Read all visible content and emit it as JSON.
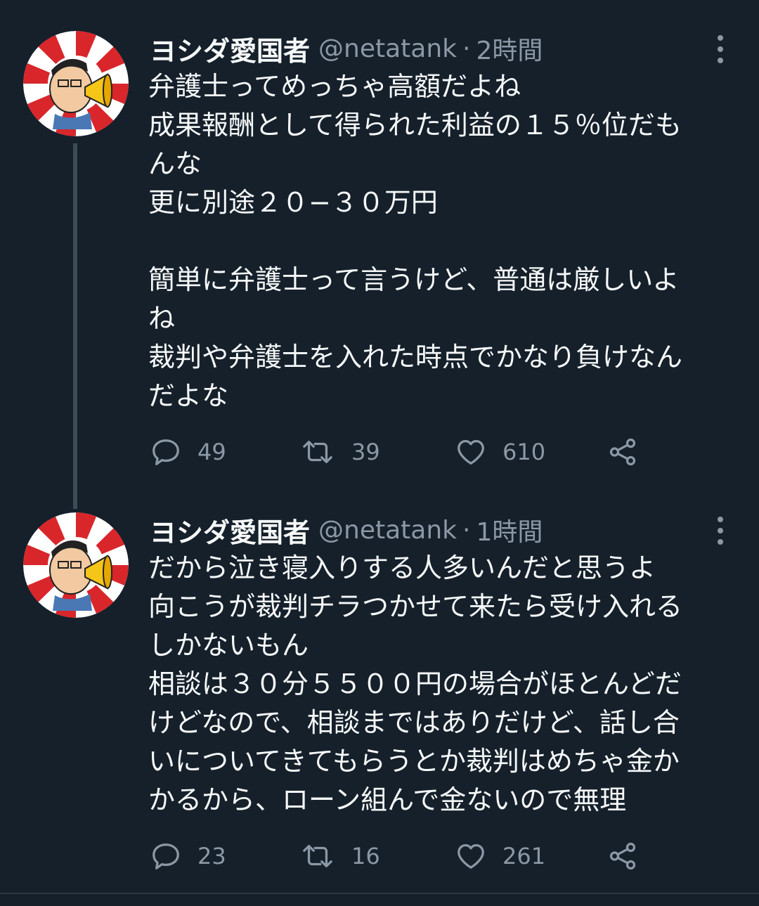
{
  "tweets": [
    {
      "name": "ヨシダ愛国者",
      "handle": "@netatank",
      "separator": "·",
      "time": "2時間",
      "lines": [
        "弁護士ってめっちゃ高額だよね",
        "成果報酬として得られた利益の１５％位だも",
        "んな",
        "更に別途２０−３０万円",
        "",
        "簡単に弁護士って言うけど、普通は厳しいよ",
        "ね",
        "裁判や弁護士を入れた時点でかなり負けなん",
        "だよな"
      ],
      "replies": "49",
      "retweets": "39",
      "likes": "610"
    },
    {
      "name": "ヨシダ愛国者",
      "handle": "@netatank",
      "separator": "·",
      "time": "1時間",
      "lines": [
        "だから泣き寝入りする人多いんだと思うよ",
        "向こうが裁判チラつかせて来たら受け入れる",
        "しかないもん",
        "相談は３０分５５００円の場合がほとんどだ",
        "けどなので、相談まではありだけど、話し合",
        "いについてきてもらうとか裁判はめちゃ金か",
        "かるから、ローン組んで金ないので無理"
      ],
      "replies": "23",
      "retweets": "16",
      "likes": "261"
    }
  ],
  "icons": {
    "reply": "speech-bubble",
    "retweet": "retweet-arrows",
    "like": "heart-outline",
    "share": "share-nodes",
    "more": "vertical-dots"
  },
  "colors": {
    "background": "#15202b",
    "text": "#f7f9f9",
    "secondary": "#8b98a5",
    "thread_line": "#3d4b57",
    "avatar_red": "#d8262b"
  }
}
